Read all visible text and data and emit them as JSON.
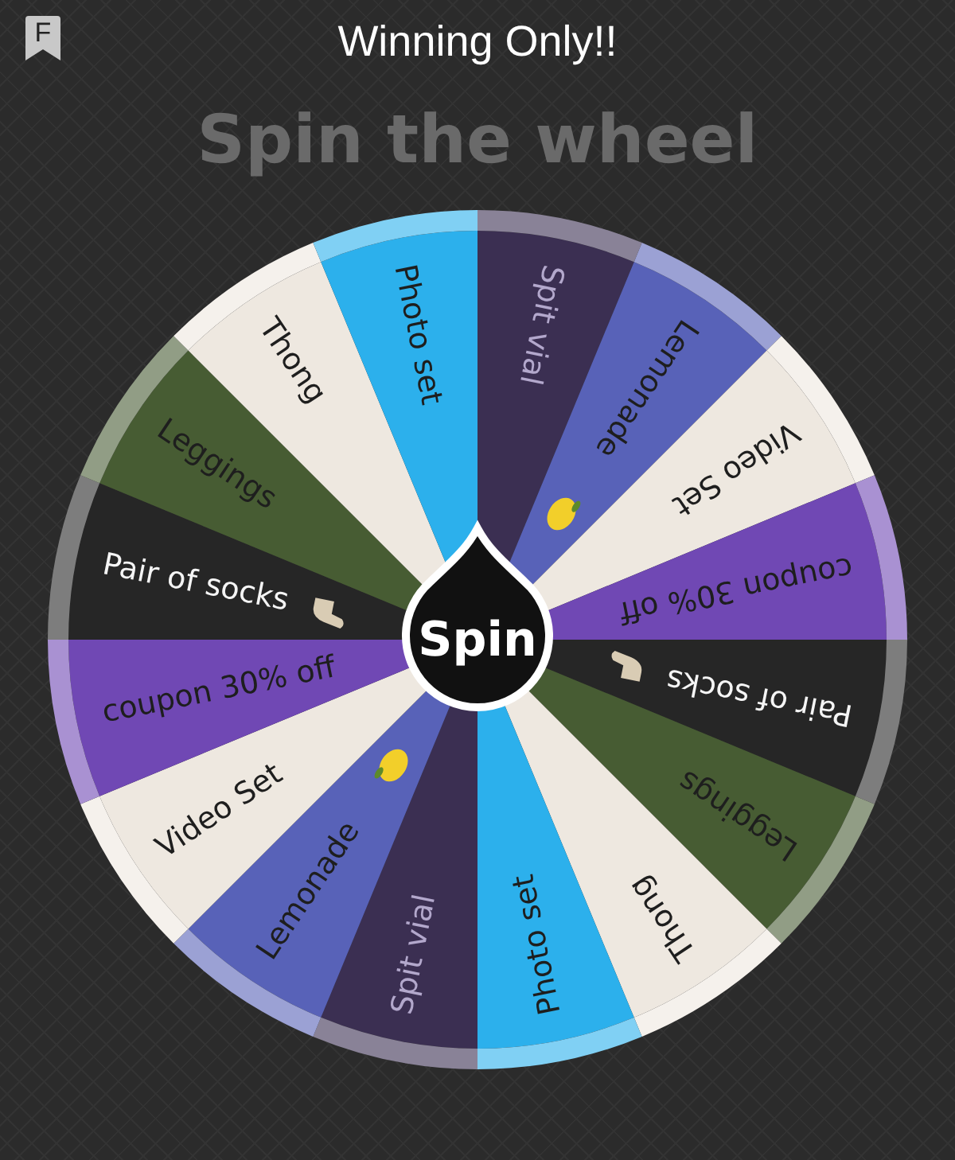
{
  "header": {
    "badge": "F",
    "title": "Winning Only!!"
  },
  "heading": "Spin the wheel",
  "segments": [
    {
      "label": "Spit vial",
      "color": "#3b2f52"
    },
    {
      "label": "Lemonade",
      "color": "#5862b8",
      "kind": "lemon"
    },
    {
      "label": "Video Set",
      "color": "#eee8e0"
    },
    {
      "label": "coupon 30% off",
      "color": "#7048b4"
    },
    {
      "label": "Pair of socks",
      "color": "#262626",
      "kind": "sock"
    },
    {
      "label": "Leggings",
      "color": "#475c33"
    },
    {
      "label": "Thong",
      "color": "#eee8e0"
    },
    {
      "label": "Photo set",
      "color": "#2cb0ec"
    },
    {
      "label": "Spit vial",
      "color": "#3b2f52"
    },
    {
      "label": "Lemonade",
      "color": "#5862b8",
      "kind": "lemon"
    },
    {
      "label": "Video Set",
      "color": "#eee8e0"
    },
    {
      "label": "coupon 30% off",
      "color": "#7048b4"
    },
    {
      "label": "Pair of socks",
      "color": "#262626",
      "kind": "sock"
    },
    {
      "label": "Leggings",
      "color": "#475c33"
    },
    {
      "label": "Thong",
      "color": "#eee8e0"
    },
    {
      "label": "Photo set",
      "color": "#2cb0ec"
    }
  ],
  "spin_button": "Spin"
}
